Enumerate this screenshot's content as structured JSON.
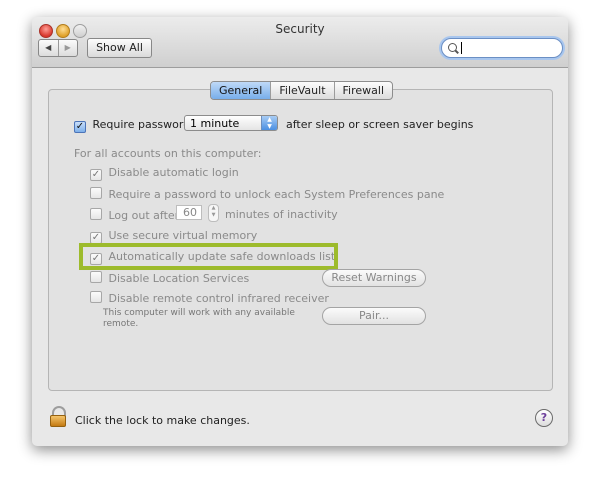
{
  "window": {
    "title": "Security",
    "nav": {
      "back_glyph": "◀",
      "forward_glyph": "▶"
    },
    "show_all_label": "Show All",
    "search": {
      "placeholder": "",
      "value": ""
    }
  },
  "tabs": [
    {
      "label": "General",
      "active": true
    },
    {
      "label": "FileVault",
      "active": false
    },
    {
      "label": "Firewall",
      "active": false
    }
  ],
  "general": {
    "require_password": {
      "checked": true,
      "label_before": "Require password",
      "select_value": "1 minute",
      "label_after": "after sleep or screen saver begins"
    },
    "section_label": "For all accounts on this computer:",
    "options": [
      {
        "label": "Disable automatic login",
        "checked": true
      },
      {
        "label": "Require a password to unlock each System Preferences pane",
        "checked": false
      },
      {
        "label_before": "Log out after",
        "value": "60",
        "label_after": "minutes of inactivity",
        "checked": false
      },
      {
        "label": "Use secure virtual memory",
        "checked": true
      },
      {
        "label": "Automatically update safe downloads list",
        "checked": true
      },
      {
        "label": "Disable Location Services",
        "checked": false
      },
      {
        "label": "Disable remote control infrared receiver",
        "checked": false
      }
    ],
    "reset_warnings_label": "Reset Warnings",
    "pair_label": "Pair...",
    "remote_note": "This computer will work with any available remote."
  },
  "footer": {
    "lock_text": "Click the lock to make changes.",
    "help_glyph": "?"
  },
  "colors": {
    "highlight": "#9dbb2c",
    "accent": "#78aeea"
  }
}
